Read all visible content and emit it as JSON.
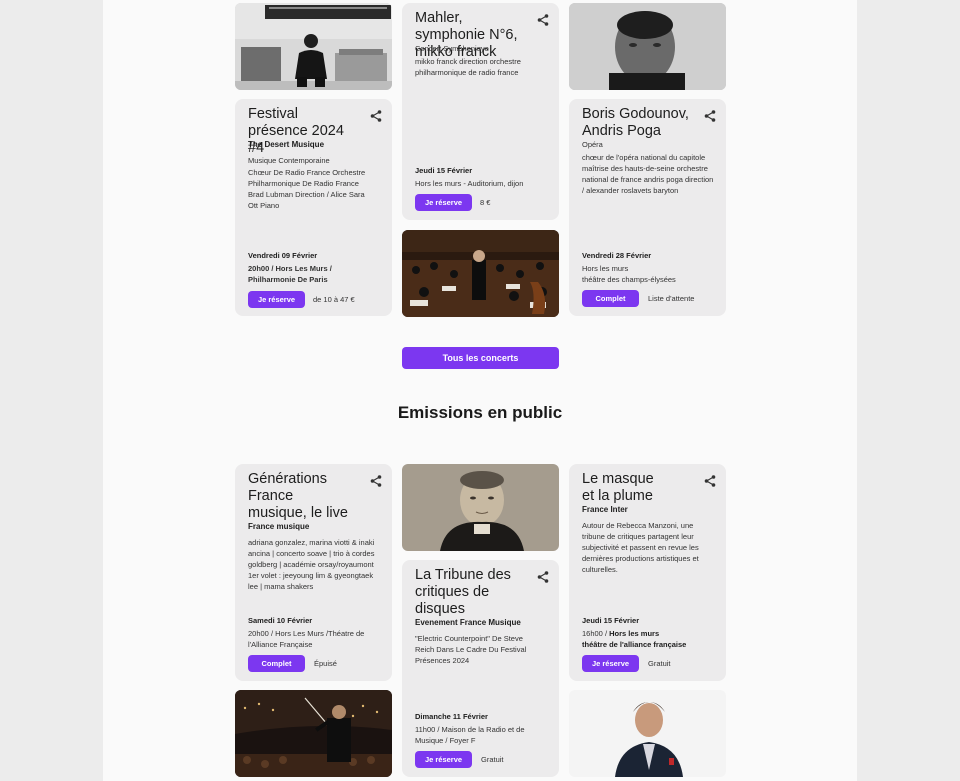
{
  "concerts": {
    "festival": {
      "title": "Festival présence 2024 #4",
      "subtitle": "The Desert Musique",
      "genre": "Musique Contemporaine",
      "description": "Chœur De Radio France Orchestre Philharmonique De Radio France Brad Lubman Direction / Alice Sara Ott Piano",
      "date": "Vendredi 09 Février",
      "time_prefix": "20h00 / ",
      "venue": "20h00 / Hors Les Murs / Philharmonie De Paris",
      "button": "Je réserve",
      "price": "de 10 à 47 €"
    },
    "mahler": {
      "title": "Mahler, symphonie N°6, mikko franck",
      "genre": "Concert Symphoniqye",
      "description": "mikko franck direction orchestre philharmonique de radio france",
      "date": "Jeudi 15 Février",
      "venue": "Hors les murs - Auditorium, dijon",
      "button": "Je réserve",
      "price": "8 €"
    },
    "boris": {
      "title": "Boris Godounov, Andris Poga",
      "genre": "Opéra",
      "description": "chœur de l'opéra national du capitole maîtrise des hauts-de-seine orchestre national de france andris poga direction / alexander roslavets baryton",
      "date": "Vendredi 28  Février",
      "venue_line1": "Hors les murs",
      "venue_line2": "théâtre des champs-élysées",
      "button": "Complet",
      "note": "Liste d'attente"
    }
  },
  "all_concerts_button": "Tous les concerts",
  "section_title": "Emissions en public",
  "emissions": {
    "generations": {
      "title": "Générations France musique, le live",
      "subtitle": "France musique",
      "description": "adriana gonzalez, marina viotti & inaki ancina | concerto soave | trio à cordes goldberg | académie orsay/royaumont 1er volet : jeeyoung lim & gyeongtaek lee | mama shakers",
      "date": "Samedi 10 Février",
      "venue": "20h00 / Hors Les Murs /Théatre de l'Alliance Française",
      "button": "Complet",
      "note": "Épuisé"
    },
    "tribune": {
      "title": "La Tribune des critiques de disques",
      "subtitle": "Evenement France Musique",
      "description": "\"Electric Counterpoint\" De Steve Reich Dans Le Cadre Du Festival Présences 2024",
      "date": "Dimanche 11 Février",
      "venue": "11h00 / Maison de la Radio et de Musique / Foyer F",
      "button": "Je réserve",
      "note": "Gratuit"
    },
    "masque": {
      "title": "Le masque et la plume",
      "subtitle": "France Inter",
      "description": "Autour de Rebecca Manzoni, une tribune de critiques partagent leur subjectivité et passent en revue les dernières productions artistiques et culturelles.",
      "date": "Jeudi 15 Février",
      "time": "16h00 / ",
      "venue_bold": "Hors les murs",
      "venue_line2": "théâtre de l'alliance française",
      "button": "Je réserve",
      "note": "Gratuit"
    }
  },
  "colors": {
    "accent": "#7c37f0",
    "card": "#ecebec",
    "page": "#fafafa",
    "outer": "#ececec"
  }
}
